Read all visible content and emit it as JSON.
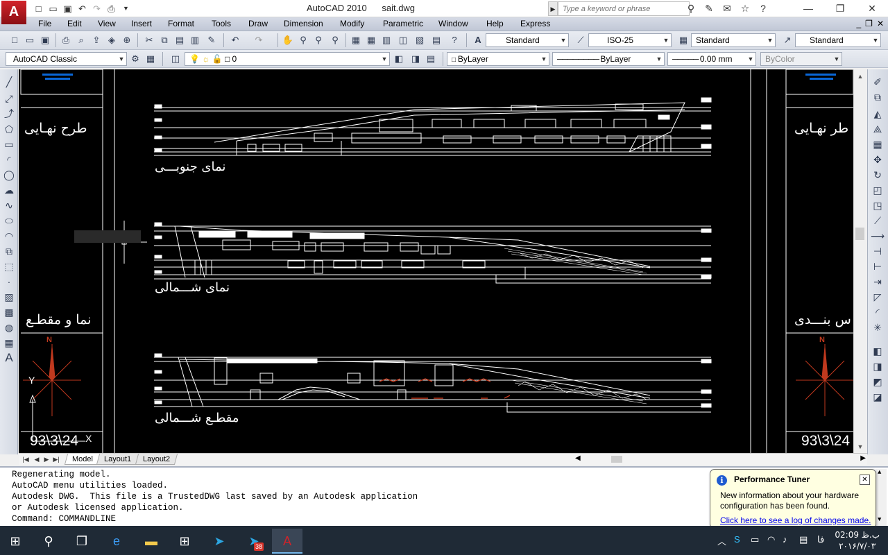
{
  "titlebar": {
    "app_logo": "A",
    "title": "AutoCAD 2010      sait.dwg",
    "search_placeholder": "Type a keyword or phrase",
    "minimize": "—",
    "restore": "❐",
    "close": "✕"
  },
  "menu": {
    "items": [
      "File",
      "Edit",
      "View",
      "Insert",
      "Format",
      "Tools",
      "Draw",
      "Dimension",
      "Modify",
      "Parametric",
      "Window",
      "Help",
      "Express"
    ]
  },
  "toolbar1": {
    "text_style": "Standard",
    "dim_style": "ISO-25",
    "table_style": "Standard",
    "multileader_style": "Standard"
  },
  "toolbar2": {
    "workspace": "AutoCAD Classic",
    "layer": "0",
    "color": "ByLayer",
    "linetype": "ByLayer",
    "lineweight": "0.00 mm",
    "plotstyle": "ByColor"
  },
  "drawing": {
    "elevation_south_label": "نمای جنوبـــی",
    "elevation_north_label": "نمای شـــمالی",
    "section_north_label": "مقطـع شـــمالی",
    "left_title_final": "طرح نهـایی",
    "left_title_sections": "نما و مقطـع",
    "right_title_final": "طر نهـایی",
    "right_title_sections": "س بنـــدی",
    "left_date": "93\\3\\24",
    "right_date": "93\\3\\24",
    "compass_north": "N",
    "ucs_y": "Y",
    "ucs_x": "X"
  },
  "layout_tabs": [
    "Model",
    "Layout1",
    "Layout2"
  ],
  "command": {
    "lines": [
      "Regenerating model.",
      "AutoCAD menu utilities loaded.",
      "Autodesk DWG.  This file is a TrustedDWG last saved by an Autodesk application",
      "or Autodesk licensed application.",
      "Command: COMMANDLINE"
    ]
  },
  "balloon": {
    "title": "Performance Tuner",
    "body": "New information about your hardware configuration has been found.",
    "link": "Click here to see a log of changes made."
  },
  "taskbar": {
    "clock_time": "02:09 ب.ظ",
    "clock_date": "۲۰۱۶/۷/۰۳",
    "language": "فا",
    "badge": "38"
  },
  "colors": {
    "canvas_bg": "#000000",
    "drawing_line": "#ffffff",
    "compass": "#c0391e",
    "accent_blue": "#0a67d8",
    "taskbar": "#1f2a36"
  }
}
